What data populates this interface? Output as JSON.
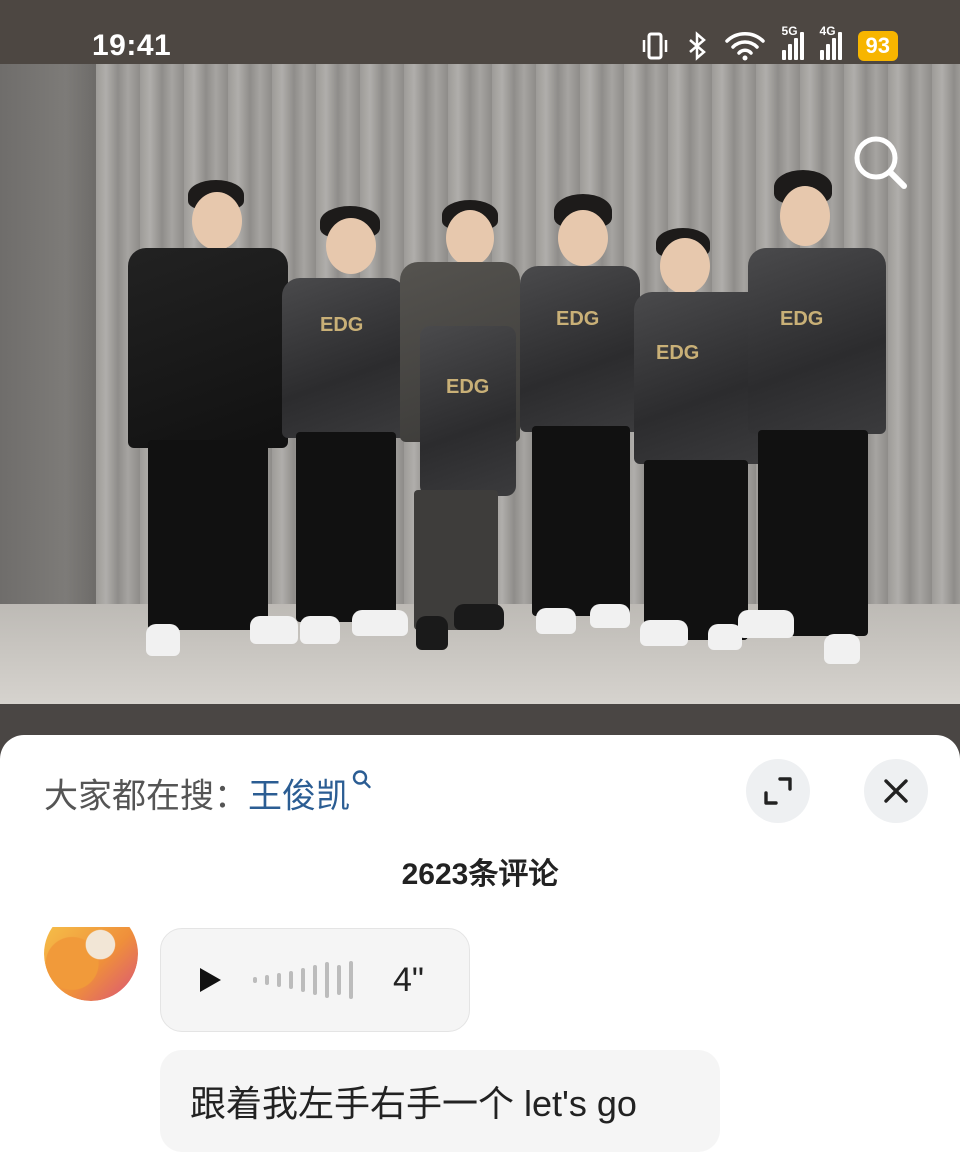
{
  "status_bar": {
    "time": "19:41",
    "network_1": "5G",
    "network_2": "4G",
    "battery": "93"
  },
  "photo": {
    "search_icon": "search-icon",
    "jersey_brand": "EDG"
  },
  "sheet": {
    "hot_search_prefix": "大家都在搜：",
    "hot_search_term": "王俊凯",
    "expand_icon": "expand-icon",
    "close_icon": "close-icon",
    "comment_count": "2623条评论",
    "comment": {
      "voice_duration": "4\"",
      "text": "跟着我左手右手一个 let's go"
    }
  },
  "colors": {
    "link": "#2b5d93",
    "battery": "#f7b500"
  }
}
